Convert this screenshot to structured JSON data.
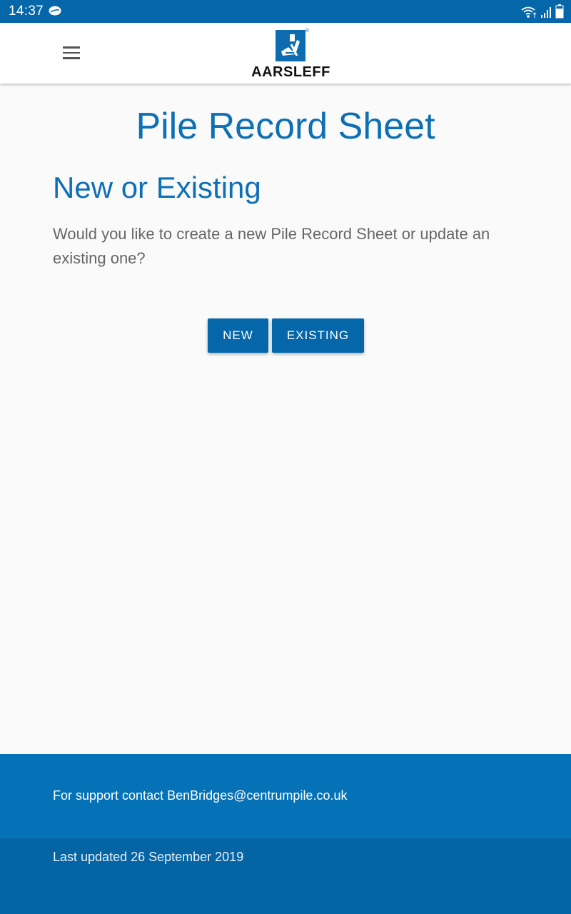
{
  "status_bar": {
    "time": "14:37",
    "icons": [
      "chat-bubble-icon",
      "wifi-icon",
      "signal-icon",
      "battery-icon"
    ]
  },
  "app_bar": {
    "logo_text": "AARSLEFF",
    "menu_icon": "hamburger-menu-icon"
  },
  "main": {
    "page_title": "Pile Record Sheet",
    "section_title": "New or Existing",
    "prompt": "Would you like to create a new Pile Record Sheet or update an existing one?",
    "new_button": "NEW",
    "existing_button": "EXISTING"
  },
  "footer": {
    "support": "For support contact BenBridges@centrumpile.co.uk",
    "updated": "Last updated 26 September 2019"
  },
  "colors": {
    "primary": "#0567aa",
    "title_blue": "#0d6fb5",
    "footer_top": "#0571b6",
    "footer_bottom": "#0565a4",
    "background": "#fafafa"
  }
}
